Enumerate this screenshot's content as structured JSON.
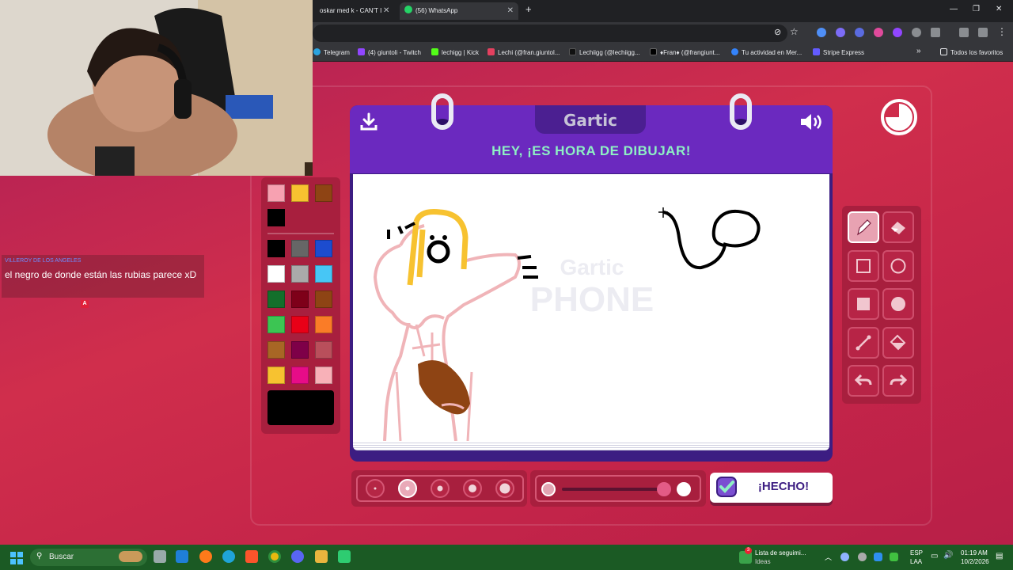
{
  "browser": {
    "tabs": [
      {
        "title": "oskar med k - CAN'T I"
      },
      {
        "title": "(56) WhatsApp"
      }
    ],
    "bookmarks": [
      {
        "label": "Telegram",
        "color": "#2aa3df"
      },
      {
        "label": "(4) giuntoli - Twitch",
        "color": "#9146ff"
      },
      {
        "label": "lechigg | Kick",
        "color": "#53fc18"
      },
      {
        "label": "Lechi (@fran.giuntol...",
        "color": "#e4405f"
      },
      {
        "label": "Lechiigg (@lechiigg...",
        "color": "#111111"
      },
      {
        "label": "♦Fran♦ (@frangiunt...",
        "color": "#000000"
      },
      {
        "label": "Tu actividad en Mer...",
        "color": "#3483fa"
      },
      {
        "label": "Stripe Express",
        "color": "#635bff"
      }
    ],
    "bookmarks_overflow": "»",
    "all_bookmarks": "Todos los favoritos"
  },
  "chat": {
    "username": "VILLEROY DE LOS ANGELES",
    "message": "el negro de donde están las rubias parece xD",
    "badge": "A"
  },
  "game": {
    "logo": "Gartic",
    "heading": "HEY, ¡ES HORA DE DIBUJAR!",
    "watermark_top": "Gartic",
    "watermark_bottom": "PHONE",
    "done_label": "¡HECHO!",
    "palette_top": [
      "#f7a1b1",
      "#f7c230",
      "#8e4414",
      "#000000"
    ],
    "palette": [
      "#000000",
      "#666666",
      "#1c4ccf",
      "#ffffff",
      "#aaaaaa",
      "#47c6f5",
      "#136f2b",
      "#7e0019",
      "#8e4414",
      "#3cc553",
      "#e80017",
      "#fa7c27",
      "#a86625",
      "#7e0048",
      "#b94f5b",
      "#f7c230",
      "#e70c88",
      "#f8b1b8"
    ],
    "current_color": "#000000",
    "brush_sizes": [
      "xs",
      "s",
      "m",
      "l",
      "xl"
    ],
    "active_brush": "s",
    "opacity_fraction": 1.0,
    "tools": [
      {
        "name": "pen",
        "active": true
      },
      {
        "name": "eraser",
        "active": false
      },
      {
        "name": "rectangle-outline",
        "active": false
      },
      {
        "name": "ellipse-outline",
        "active": false
      },
      {
        "name": "rectangle-filled",
        "active": false
      },
      {
        "name": "ellipse-filled",
        "active": false
      },
      {
        "name": "line",
        "active": false
      },
      {
        "name": "fill-bucket",
        "active": false
      },
      {
        "name": "undo",
        "active": false
      },
      {
        "name": "redo",
        "active": false
      }
    ]
  },
  "taskbar": {
    "search_placeholder": "Buscar",
    "news_title": "Lista de seguimi...",
    "news_sub": "Ideas",
    "news_badge": "3",
    "lang": "ESP",
    "lang2": "LAA",
    "time": "01:19 AM",
    "date": "10/2/2026"
  }
}
